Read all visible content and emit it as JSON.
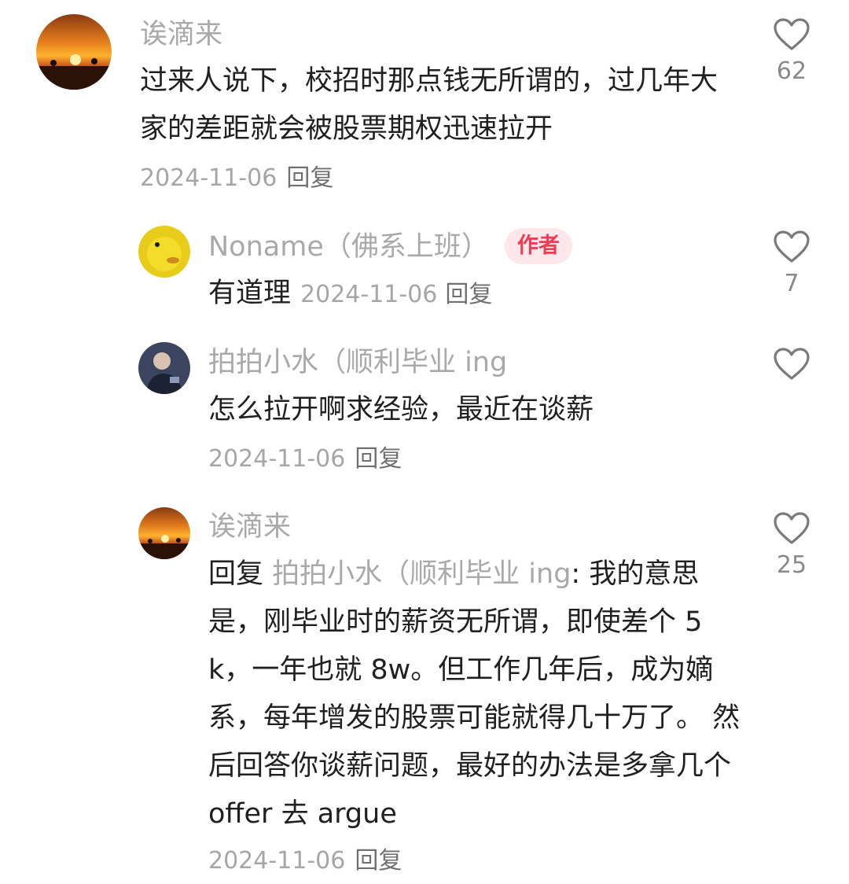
{
  "comments": [
    {
      "username": "诶滴来",
      "text": "过来人说下，校招时那点钱无所谓的，过几年大家的差距就会被股票期权迅速拉开",
      "date": "2024-11-06",
      "reply_label": "回复",
      "likes": "62",
      "avatar": "sunset-avatar"
    },
    {
      "username": "Noname（佛系上班）",
      "badge": "作者",
      "text": "有道理",
      "date": "2024-11-06",
      "reply_label": "回复",
      "likes": "7",
      "avatar": "yellow-duck-avatar"
    },
    {
      "username": "拍拍小水（顺利毕业 ing",
      "text": "怎么拉开啊求经验，最近在谈薪",
      "date": "2024-11-06",
      "reply_label": "回复",
      "likes": "",
      "avatar": "person-avatar"
    },
    {
      "username": "诶滴来",
      "reply_prefix": "回复",
      "reply_target": "拍拍小水（顺利毕业 ing",
      "text": ": 我的意思是，刚毕业时的薪资无所谓，即使差个 5k，一年也就 8w。但工作几年后，成为嫡系，每年增发的股票可能就得几十万了。 然后回答你谈薪问题，最好的办法是多拿几个 offer 去 argue",
      "date": "2024-11-06",
      "reply_label": "回复",
      "likes": "25",
      "avatar": "sunset-avatar"
    }
  ]
}
